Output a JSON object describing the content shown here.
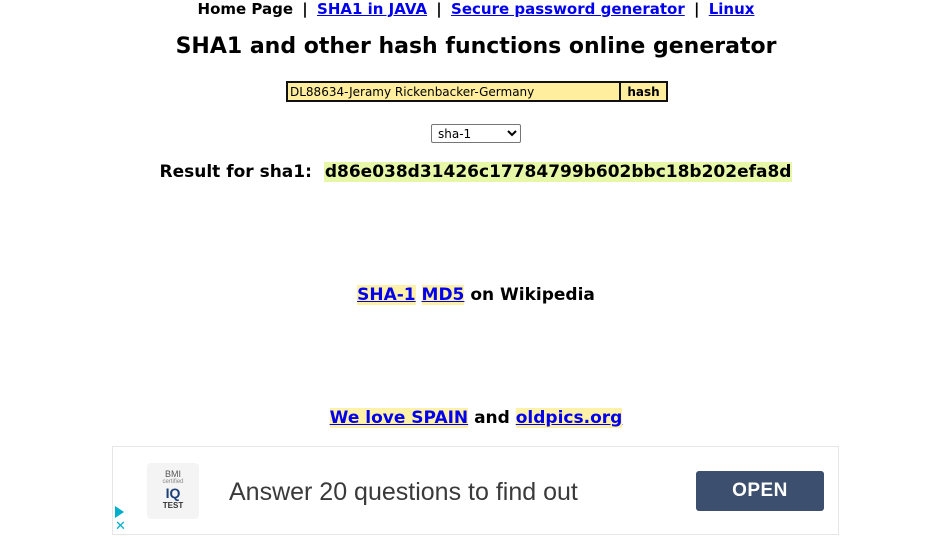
{
  "nav": {
    "home": "Home Page",
    "sep": "|",
    "links": [
      "SHA1 in JAVA",
      "Secure password generator",
      "Linux"
    ]
  },
  "title": "SHA1 and other hash functions online generator",
  "form": {
    "input_value": "DL88634-Jeramy Rickenbacker-Germany",
    "button_label": "hash",
    "algorithm": "sha-1"
  },
  "result": {
    "label": "Result for sha1:",
    "hash": "d86e038d31426c17784799b602bbc18b202efa8d"
  },
  "wiki": {
    "links": [
      "SHA-1",
      "MD5"
    ],
    "suffix": "on Wikipedia"
  },
  "promo": {
    "link1": "We love SPAIN",
    "conj": "and",
    "link2": "oldpics.org"
  },
  "ad": {
    "logo_line1": "BMI",
    "logo_line2": "certified",
    "logo_line3": "IQ",
    "logo_line4": "TEST",
    "text": "Answer 20 questions to find out",
    "cta": "OPEN",
    "brand_color": "#3d4f6e",
    "choices_color": "#00aecd"
  },
  "colors": {
    "link": "#0000ee",
    "input_bg": "#ffee9e",
    "hash_bg": "#e6f7a8",
    "link_highlight": "#fff2a8"
  }
}
